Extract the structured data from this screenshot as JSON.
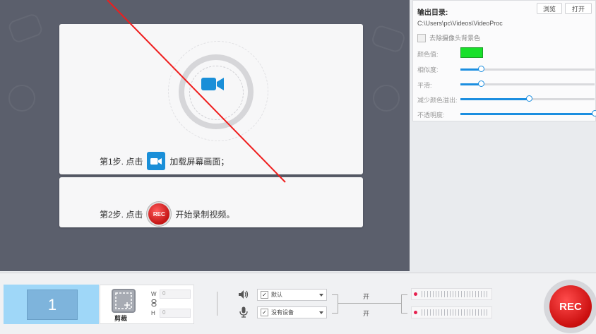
{
  "preview": {
    "step1_prefix": "第1步. 点击",
    "step1_suffix": "加载屏幕画面；",
    "step2_prefix": "第2步. 点击",
    "step2_suffix": "开始录制视频。",
    "rec_badge": "REC",
    "camera_icon": "video-camera-icon"
  },
  "settings": {
    "output_dir_label": "输出目录:",
    "browse_button": "浏览",
    "open_button": "打开",
    "output_path": "C:\\Users\\pc\\Videos\\VideoProc",
    "remove_bg_label": "去除摄像头背景色",
    "color_label": "颜色值:",
    "color_value": "#18e02a",
    "similarity_label": "相似度:",
    "similarity_value": 0.15,
    "smooth_label": "平滑:",
    "smooth_value": 0.15,
    "reduce_color_label": "减少颜色溢出:",
    "reduce_color_value": 0.51,
    "opacity_label": "不透明度:",
    "opacity_value": 1.0
  },
  "toolbar": {
    "screen_number": "1",
    "crop_label": "剪裁",
    "width_label": "W",
    "height_label": "H",
    "width_value": "0",
    "height_value": "0",
    "audio_device": "默认",
    "mic_device": "没有设备",
    "audio_state": "开",
    "mic_state": "开",
    "rec_button": "REC",
    "speaker_icon": "speaker-icon",
    "mic_icon": "microphone-icon"
  }
}
